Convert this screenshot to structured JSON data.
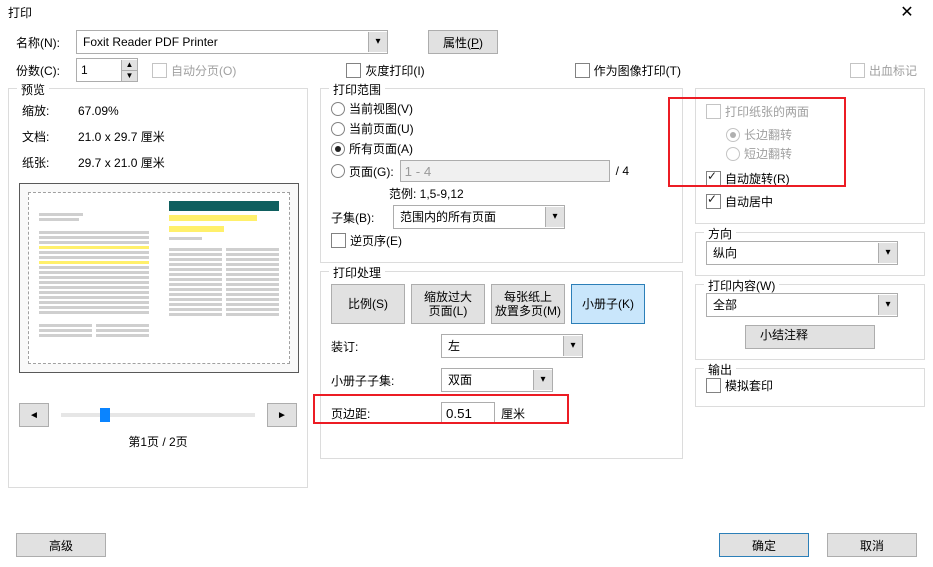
{
  "window": {
    "title": "打印"
  },
  "top": {
    "name_label": "名称(N):",
    "printer": "Foxit Reader PDF Printer",
    "properties_btn": "属性(P)",
    "copies_label": "份数(C):",
    "copies_value": "1",
    "collate_label": "自动分页(O)",
    "grayscale_label": "灰度打印(I)",
    "as_image_label": "作为图像打印(T)",
    "bleed_label": "出血标记"
  },
  "preview": {
    "title": "预览",
    "zoom_label": "缩放:",
    "zoom_value": "67.09%",
    "doc_label": "文档:",
    "doc_size": "21.0 x 29.7 厘米",
    "paper_label": "纸张:",
    "paper_size": "29.7 x 21.0 厘米",
    "page_of": "第1页 / 2页"
  },
  "range": {
    "title": "打印范围",
    "current_view": "当前视图(V)",
    "current_page": "当前页面(U)",
    "all_pages": "所有页面(A)",
    "pages": "页面(G):",
    "pages_value": "1 - 4",
    "pages_total": "/ 4",
    "example_label": "范例: 1,5-9,12",
    "subset_label": "子集(B):",
    "subset_value": "范围内的所有页面",
    "reverse_label": "逆页序(E)"
  },
  "duplex": {
    "duplex_label": "打印纸张的两面",
    "long_edge": "长边翻转",
    "short_edge": "短边翻转",
    "auto_rotate": "自动旋转(R)",
    "auto_center": "自动居中"
  },
  "handling": {
    "title": "打印处理",
    "tab_scale": "比例(S)",
    "tab_fit": "缩放过大\n页面(L)",
    "tab_multi": "每张纸上\n放置多页(M)",
    "tab_booklet": "小册子(K)",
    "binding_label": "装订:",
    "binding_value": "左",
    "subset_label": "小册子子集:",
    "subset_value": "双面",
    "margin_label": "页边距:",
    "margin_value": "0.51",
    "margin_unit": "厘米"
  },
  "orientation": {
    "title": "方向",
    "value": "纵向"
  },
  "content": {
    "title": "打印内容(W)",
    "value": "全部",
    "summarize_btn": "小结注释"
  },
  "output": {
    "title": "输出",
    "simulate_label": "模拟套印"
  },
  "bottom": {
    "advanced": "高级",
    "ok": "确定",
    "cancel": "取消"
  }
}
